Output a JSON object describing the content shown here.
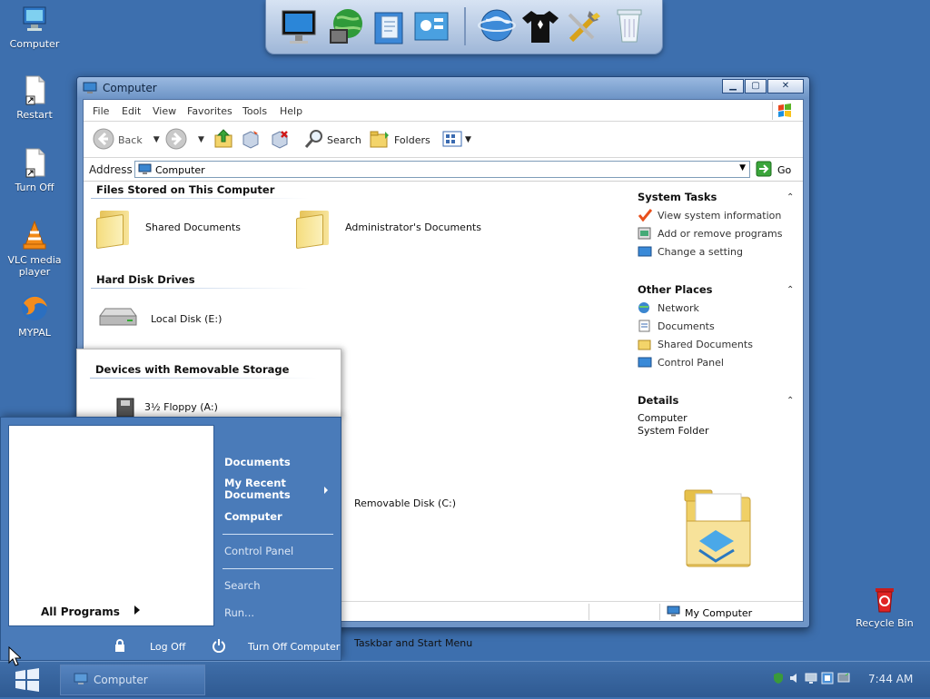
{
  "desktop": {
    "icons": [
      {
        "label": "Computer"
      },
      {
        "label": "Restart"
      },
      {
        "label": "Turn Off"
      },
      {
        "label": "VLC media player"
      },
      {
        "label": "MYPAL"
      },
      {
        "label": "Recycle Bin"
      }
    ]
  },
  "window": {
    "title": "Computer",
    "menu": [
      "File",
      "Edit",
      "View",
      "Favorites",
      "Tools",
      "Help"
    ],
    "toolbar": {
      "back": "Back",
      "search": "Search",
      "folders": "Folders"
    },
    "address": {
      "label": "Address",
      "value": "Computer",
      "go": "Go"
    },
    "sections": {
      "files_stored": "Files Stored on This Computer",
      "hard_disks": "Hard Disk Drives",
      "removable": "Devices with Removable Storage"
    },
    "items": {
      "shared_docs": "Shared Documents",
      "admin_docs": "Administrator's Documents",
      "local_disk": "Local Disk (E:)",
      "floppy": "3½ Floppy (A:)",
      "removable_disk": "Removable Disk (C:)",
      "taskbar_start": "Taskbar and Start Menu"
    },
    "tasks": {
      "system_title": "System Tasks",
      "system_links": [
        "View system information",
        "Add or remove programs",
        "Change a setting"
      ],
      "other_title": "Other Places",
      "other_links": [
        "Network",
        "Documents",
        "Shared Documents",
        "Control Panel"
      ],
      "details_title": "Details",
      "details_lines": [
        "Computer",
        "System Folder"
      ]
    },
    "status": {
      "location": "My Computer"
    }
  },
  "startmenu": {
    "all_programs": "All Programs",
    "right": {
      "documents": "Documents",
      "recent": "My Recent Documents",
      "computer": "Computer",
      "control_panel": "Control Panel",
      "search": "Search",
      "run": "Run..."
    },
    "log_off": "Log Off",
    "turn_off": "Turn Off Computer"
  },
  "taskbar": {
    "task_label": "Computer",
    "clock": "7:44 AM"
  }
}
